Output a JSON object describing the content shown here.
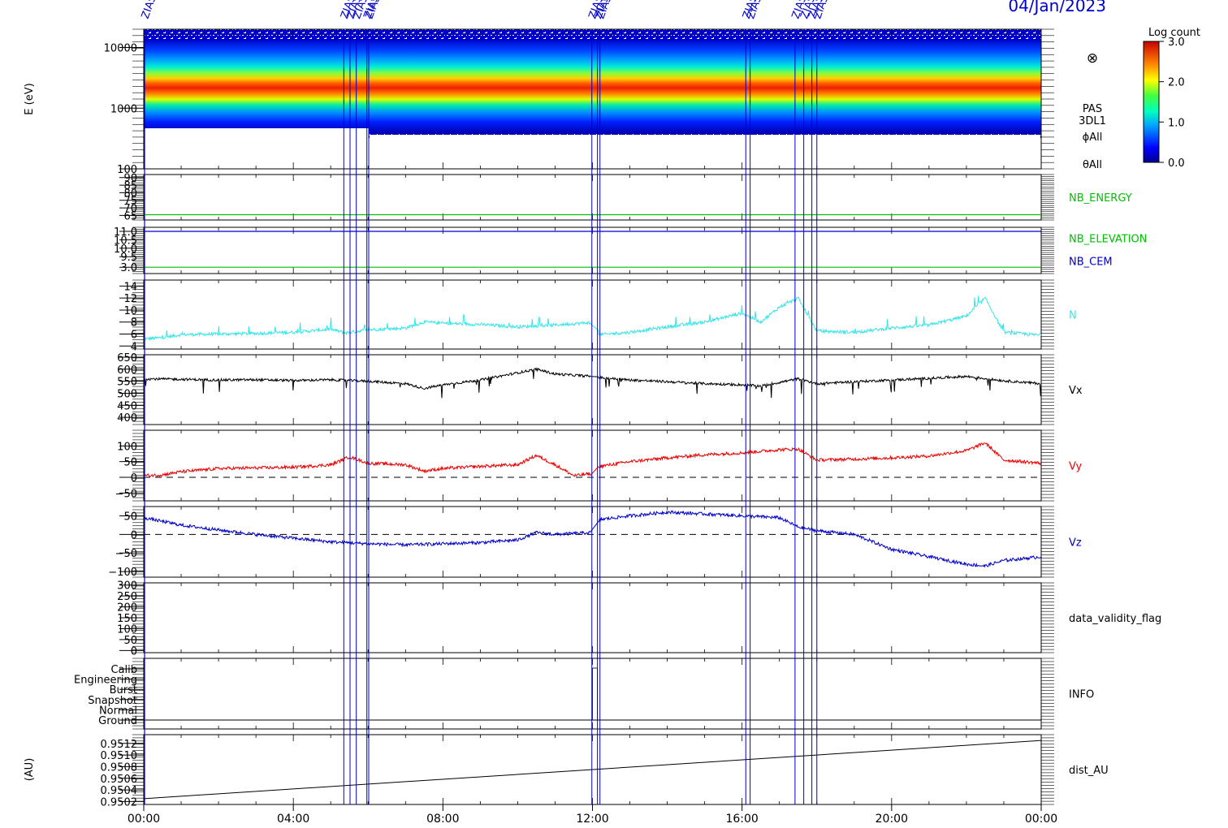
{
  "header": {
    "date": "04/Jan/2023"
  },
  "colorbar": {
    "title": "Log count",
    "ticks": [
      "3.0",
      "2.0",
      "1.0",
      "0.0"
    ],
    "range": [
      0,
      3
    ]
  },
  "energy_panel": {
    "ylabel": "E (eV)",
    "labels": [
      "PAS",
      "3DL1",
      "ϕAll",
      "θAll"
    ],
    "yticks": [
      "10000",
      "1000",
      "100"
    ],
    "ylim": [
      100,
      20000
    ],
    "scale": "log",
    "symbol": "⊗"
  },
  "event_markers": {
    "label": "ZIAS",
    "times": [
      "05:21",
      "05:31",
      "05:41",
      "05:58",
      "06:01",
      "11:59",
      "12:08",
      "12:12",
      "16:06",
      "16:13",
      "17:25",
      "17:39",
      "17:52",
      "18:00"
    ]
  },
  "axis": {
    "xticks": [
      "00:00",
      "04:00",
      "08:00",
      "12:00",
      "16:00",
      "20:00",
      "00:00"
    ],
    "range_hours": [
      0,
      24
    ]
  },
  "chart_data": [
    {
      "type": "heatmap",
      "name": "PAS 3DL1",
      "value_unit": "Log count",
      "band_center_eV": [
        [
          0,
          1500
        ],
        [
          7,
          1400
        ],
        [
          8,
          1450
        ],
        [
          10,
          1650
        ],
        [
          11,
          1700
        ],
        [
          12,
          1550
        ],
        [
          16,
          1550
        ],
        [
          17.5,
          1700
        ],
        [
          18,
          1650
        ],
        [
          22,
          1800
        ],
        [
          23,
          1600
        ],
        [
          24,
          1600
        ]
      ]
    },
    {
      "type": "line",
      "name": "NB_ENERGY",
      "label": "NB_ENERGY",
      "yticks": [
        "90",
        "85",
        "80",
        "75",
        "70",
        "65"
      ],
      "ylim": [
        62,
        92
      ],
      "value": 65.5,
      "color": "#00c000"
    },
    {
      "type": "line",
      "label": "NB_ELEVATION",
      "label2": "NB_CEM",
      "yticks": [
        "11.0",
        "10.5",
        "10.0",
        "9.5",
        "3.0"
      ],
      "value": 3.0,
      "value2": 11.0,
      "color": "#00c000",
      "color2": "#0000cc"
    },
    {
      "type": "line",
      "label": "N",
      "yticks": [
        "14",
        "12",
        "10",
        "8",
        "6",
        "4"
      ],
      "ylim": [
        3.5,
        15
      ],
      "color": "#33e6e6",
      "x": [
        0,
        0.5,
        1,
        2,
        3,
        4,
        5,
        5.4,
        6,
        7,
        7.5,
        8,
        9,
        10,
        11,
        11.9,
        12.2,
        13,
        14,
        15,
        16,
        16.5,
        17,
        17.5,
        18,
        19,
        20,
        21,
        22,
        22.5,
        23,
        24
      ],
      "y": [
        5.2,
        5.4,
        5.9,
        6.0,
        6.1,
        6.3,
        6.8,
        6.2,
        6.7,
        7.0,
        8.0,
        7.8,
        7.6,
        7.2,
        7.5,
        7.9,
        5.9,
        6.3,
        7.2,
        8.0,
        9.5,
        8.0,
        10.5,
        12.0,
        6.5,
        6.3,
        7.0,
        7.5,
        9.0,
        12.0,
        6.3,
        5.8
      ]
    },
    {
      "type": "line",
      "label": "Vx",
      "yticks": [
        "650",
        "600",
        "550",
        "500",
        "450",
        "400"
      ],
      "ylim": [
        370,
        660
      ],
      "color": "#000000",
      "x": [
        0,
        1,
        2,
        3,
        4,
        5,
        6,
        7,
        7.5,
        8,
        9,
        10,
        10.5,
        11,
        12,
        12.2,
        13,
        14,
        15,
        16,
        16.5,
        17,
        17.5,
        18,
        19,
        20,
        21,
        22,
        23,
        24
      ],
      "y": [
        560,
        558,
        555,
        556,
        553,
        556,
        550,
        540,
        520,
        535,
        555,
        585,
        600,
        580,
        570,
        565,
        555,
        548,
        540,
        535,
        530,
        545,
        560,
        540,
        548,
        555,
        562,
        570,
        552,
        540
      ]
    },
    {
      "type": "line",
      "label": "Vy",
      "yticks": [
        "100",
        "50",
        "0",
        "−50"
      ],
      "ylim": [
        -75,
        150
      ],
      "zero_line": true,
      "color": "#ee0000",
      "x": [
        0,
        0.5,
        1,
        2,
        3,
        4,
        5,
        5.5,
        6,
        7,
        7.5,
        8,
        9,
        10,
        10.5,
        11,
        11.5,
        12,
        12.2,
        13,
        14,
        15,
        16,
        17,
        17.5,
        18,
        19,
        20,
        21,
        22,
        22.5,
        23,
        24
      ],
      "y": [
        5,
        8,
        18,
        28,
        30,
        32,
        40,
        65,
        45,
        40,
        20,
        28,
        35,
        40,
        70,
        40,
        5,
        12,
        35,
        50,
        62,
        72,
        78,
        88,
        90,
        55,
        58,
        62,
        68,
        85,
        110,
        55,
        45
      ]
    },
    {
      "type": "line",
      "label": "Vz",
      "yticks": [
        "50",
        "0",
        "−50",
        "−100"
      ],
      "ylim": [
        -115,
        75
      ],
      "zero_line": true,
      "color": "#0000cc",
      "x": [
        0,
        1,
        2,
        3,
        4,
        5,
        6,
        7,
        8,
        9,
        10,
        10.5,
        11,
        12,
        12.2,
        13,
        14,
        15,
        16,
        17,
        17.5,
        18,
        19,
        20,
        21,
        22,
        22.5,
        23,
        24
      ],
      "y": [
        45,
        25,
        12,
        0,
        -10,
        -20,
        -25,
        -28,
        -25,
        -22,
        -15,
        5,
        0,
        5,
        40,
        50,
        60,
        55,
        50,
        45,
        20,
        10,
        0,
        -40,
        -60,
        -80,
        -85,
        -70,
        -60
      ]
    },
    {
      "type": "line",
      "label": "data_validity_flag",
      "yticks": [
        "300",
        "250",
        "200",
        "150",
        "100",
        "50",
        "0"
      ],
      "ylim": [
        -10,
        310
      ],
      "value": 0
    },
    {
      "type": "line",
      "label": "INFO",
      "states": [
        "Calib",
        "Engineering",
        "Burst",
        "Snapshot",
        "Normal",
        "Ground"
      ],
      "value": "Ground"
    },
    {
      "type": "line",
      "label": "dist_AU",
      "ylabel": "(AU)",
      "yticks": [
        "0.9512",
        "0.9510",
        "0.9508",
        "0.9506",
        "0.9504",
        "0.9502"
      ],
      "ylim": [
        0.95015,
        0.95135
      ],
      "color": "#000000",
      "x": [
        0,
        24
      ],
      "y": [
        0.95025,
        0.95125
      ]
    }
  ]
}
